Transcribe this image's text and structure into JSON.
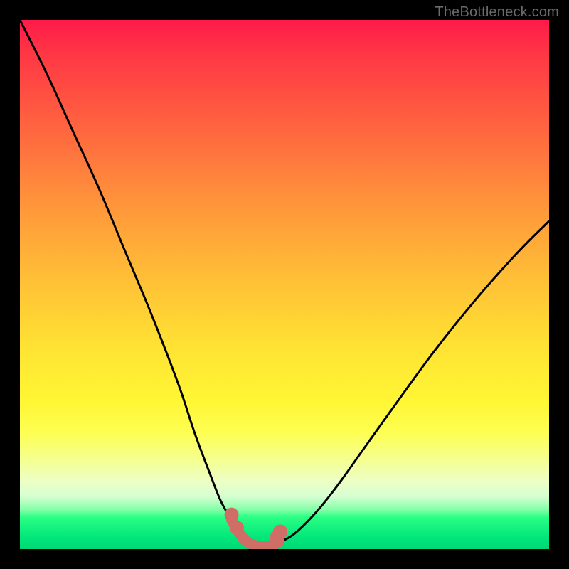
{
  "watermark": "TheBottleneck.com",
  "colors": {
    "frame": "#000000",
    "curve": "#000000",
    "highlight": "#cf6d66",
    "gradient_top": "#ff1a49",
    "gradient_bottom": "#00d876"
  },
  "chart_data": {
    "type": "line",
    "title": "",
    "xlabel": "",
    "ylabel": "",
    "xlim": [
      0,
      100
    ],
    "ylim": [
      0,
      100
    ],
    "series": [
      {
        "name": "bottleneck-curve",
        "x": [
          0,
          5,
          10,
          15,
          20,
          25,
          30,
          33,
          36,
          38,
          40,
          41.5,
          43,
          45,
          47,
          49,
          52,
          56,
          60,
          65,
          70,
          78,
          86,
          94,
          100
        ],
        "y": [
          100,
          90,
          79,
          68,
          56,
          44,
          31,
          22,
          14,
          9,
          5.5,
          3,
          1.3,
          0.6,
          0.6,
          1.3,
          3,
          7,
          12,
          19,
          26,
          37,
          47,
          56,
          62
        ]
      }
    ],
    "highlight": {
      "name": "optimal-range",
      "x": [
        40,
        41.5,
        43,
        45,
        47,
        49
      ],
      "y": [
        5.5,
        3,
        1.3,
        0.6,
        0.6,
        1.3
      ],
      "dot_x": [
        40,
        41,
        48.6,
        49.2
      ],
      "dot_y": [
        6.5,
        4.0,
        2.2,
        3.3
      ]
    }
  }
}
